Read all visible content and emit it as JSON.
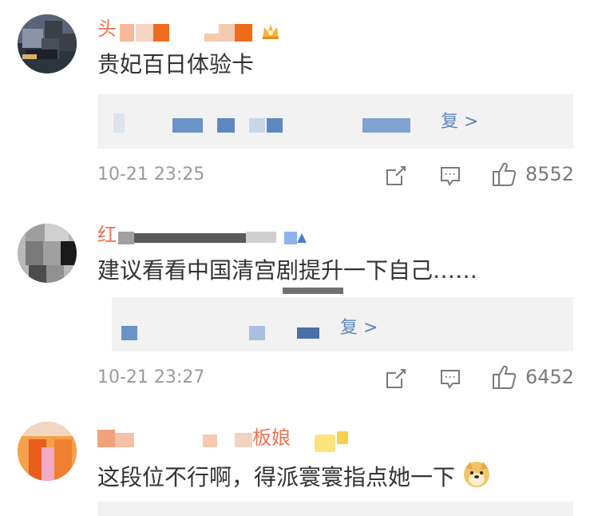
{
  "comments": [
    {
      "username": "头",
      "text": "贵妃百日体验卡",
      "reply_link": "复 >",
      "time": "10-21 23:25",
      "likes": "8552"
    },
    {
      "username": "红",
      "text": "建议看看中国清宫剧提升一下自己……",
      "reply_link": "复 >",
      "time": "10-21 23:27",
      "likes": "6452"
    },
    {
      "username": "板娘",
      "text": "这段位不行啊，得派寰寰指点她一下",
      "emoji_icon": "doge-emoji-icon"
    }
  ],
  "colors": {
    "username": "#eb7350",
    "link": "#5e86c1",
    "meta": "#9a9a9a",
    "reply_bg": "#f2f2f2"
  },
  "icons": [
    "share-icon",
    "comment-icon",
    "like-icon",
    "vip-crown-icon",
    "vip-badge-icon"
  ]
}
